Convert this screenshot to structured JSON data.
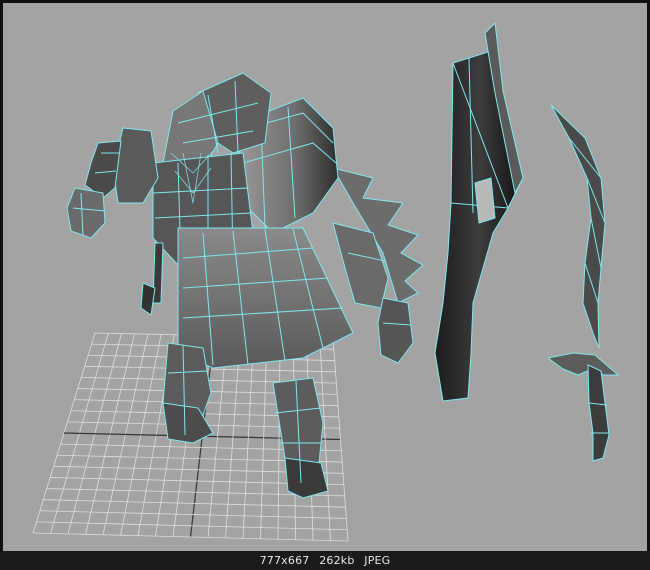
{
  "viewport": {
    "background": "#a3a3a3",
    "wire_color": "#7fe7ee",
    "grid_color": "#e2e2e2",
    "objects": [
      "character-mesh",
      "scabbard-mesh",
      "curved-sword-mesh",
      "ground-grid"
    ]
  },
  "statusbar": {
    "dimensions": "777x667",
    "filesize": "262kb",
    "format": "JPEG"
  }
}
